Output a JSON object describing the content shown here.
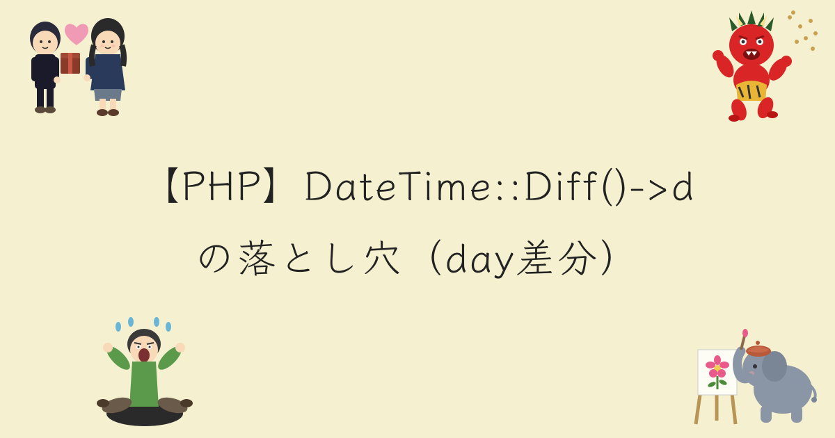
{
  "title": {
    "line1": "【PHP】DateTime::Diff()->d",
    "line2": "の落とし穴（day差分）"
  },
  "illustrations": {
    "top_left": "couple-giving-gift",
    "top_right": "red-oni-demon",
    "bottom_left": "person-falling-in-hole",
    "bottom_right": "elephant-painting"
  }
}
